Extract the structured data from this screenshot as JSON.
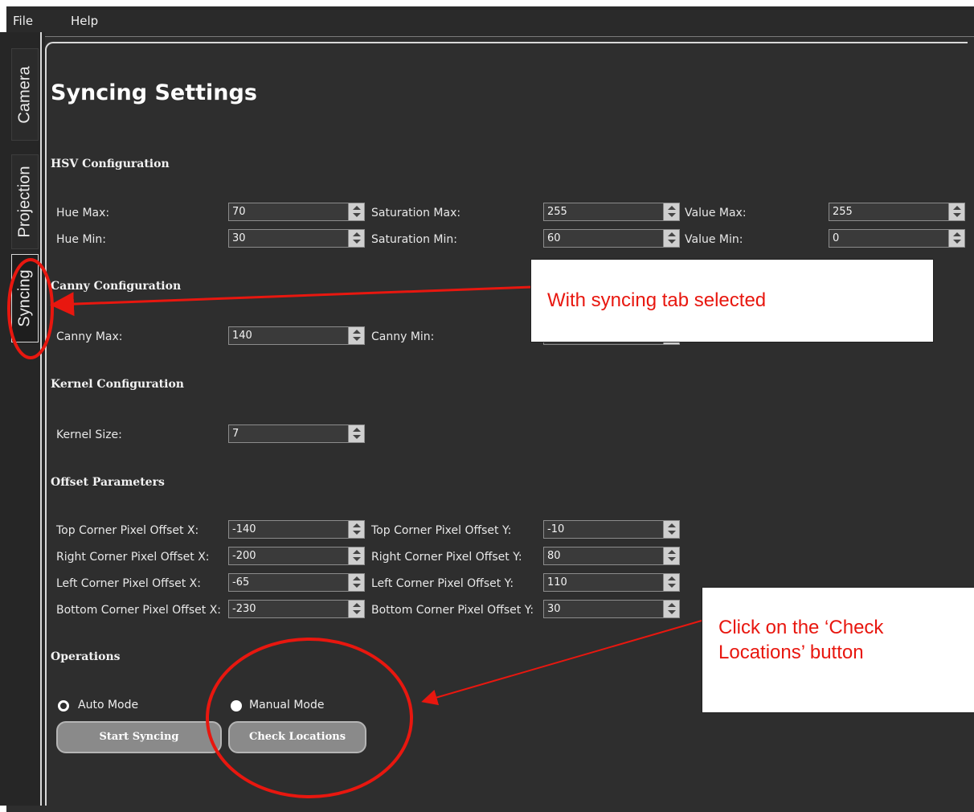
{
  "menu": {
    "file": "File",
    "help": "Help"
  },
  "tabs": {
    "camera": "Camera",
    "projection": "Projection",
    "syncing": "Syncing"
  },
  "page_title": "Syncing Settings",
  "hsv": {
    "title": "HSV Configuration",
    "hue_max": {
      "label": "Hue Max:",
      "value": "70"
    },
    "hue_min": {
      "label": "Hue Min:",
      "value": "30"
    },
    "sat_max": {
      "label": "Saturation Max:",
      "value": "255"
    },
    "sat_min": {
      "label": "Saturation Min:",
      "value": "60"
    },
    "val_max": {
      "label": "Value Max:",
      "value": "255"
    },
    "val_min": {
      "label": "Value Min:",
      "value": "0"
    }
  },
  "canny": {
    "title": "Canny Configuration",
    "max": {
      "label": "Canny Max:",
      "value": "140"
    },
    "min": {
      "label": "Canny Min:"
    }
  },
  "kernel": {
    "title": "Kernel Configuration",
    "size": {
      "label": "Kernel Size:",
      "value": "7"
    }
  },
  "offset": {
    "title": "Offset Parameters",
    "top_x": {
      "label": "Top Corner Pixel Offset X:",
      "value": "-140"
    },
    "top_y": {
      "label": "Top Corner Pixel Offset Y:",
      "value": "-10"
    },
    "right_x": {
      "label": "Right Corner Pixel Offset X:",
      "value": "-200"
    },
    "right_y": {
      "label": "Right Corner Pixel Offset Y:",
      "value": "80"
    },
    "left_x": {
      "label": "Left Corner Pixel Offset X:",
      "value": "-65"
    },
    "left_y": {
      "label": "Left Corner Pixel Offset Y:",
      "value": "110"
    },
    "bottom_x": {
      "label": "Bottom Corner Pixel Offset X:",
      "value": "-230"
    },
    "bottom_y": {
      "label": "Bottom Corner Pixel Offset Y:",
      "value": "30"
    }
  },
  "operations": {
    "title": "Operations",
    "auto_mode": "Auto Mode",
    "manual_mode": "Manual Mode",
    "selected_mode": "Manual Mode",
    "start_syncing": "Start Syncing",
    "check_locations": "Check Locations"
  },
  "annotations": {
    "tab_callout": "With syncing tab selected",
    "button_callout": "Click on the ‘Check Locations’ button",
    "color": "#e8170f"
  }
}
